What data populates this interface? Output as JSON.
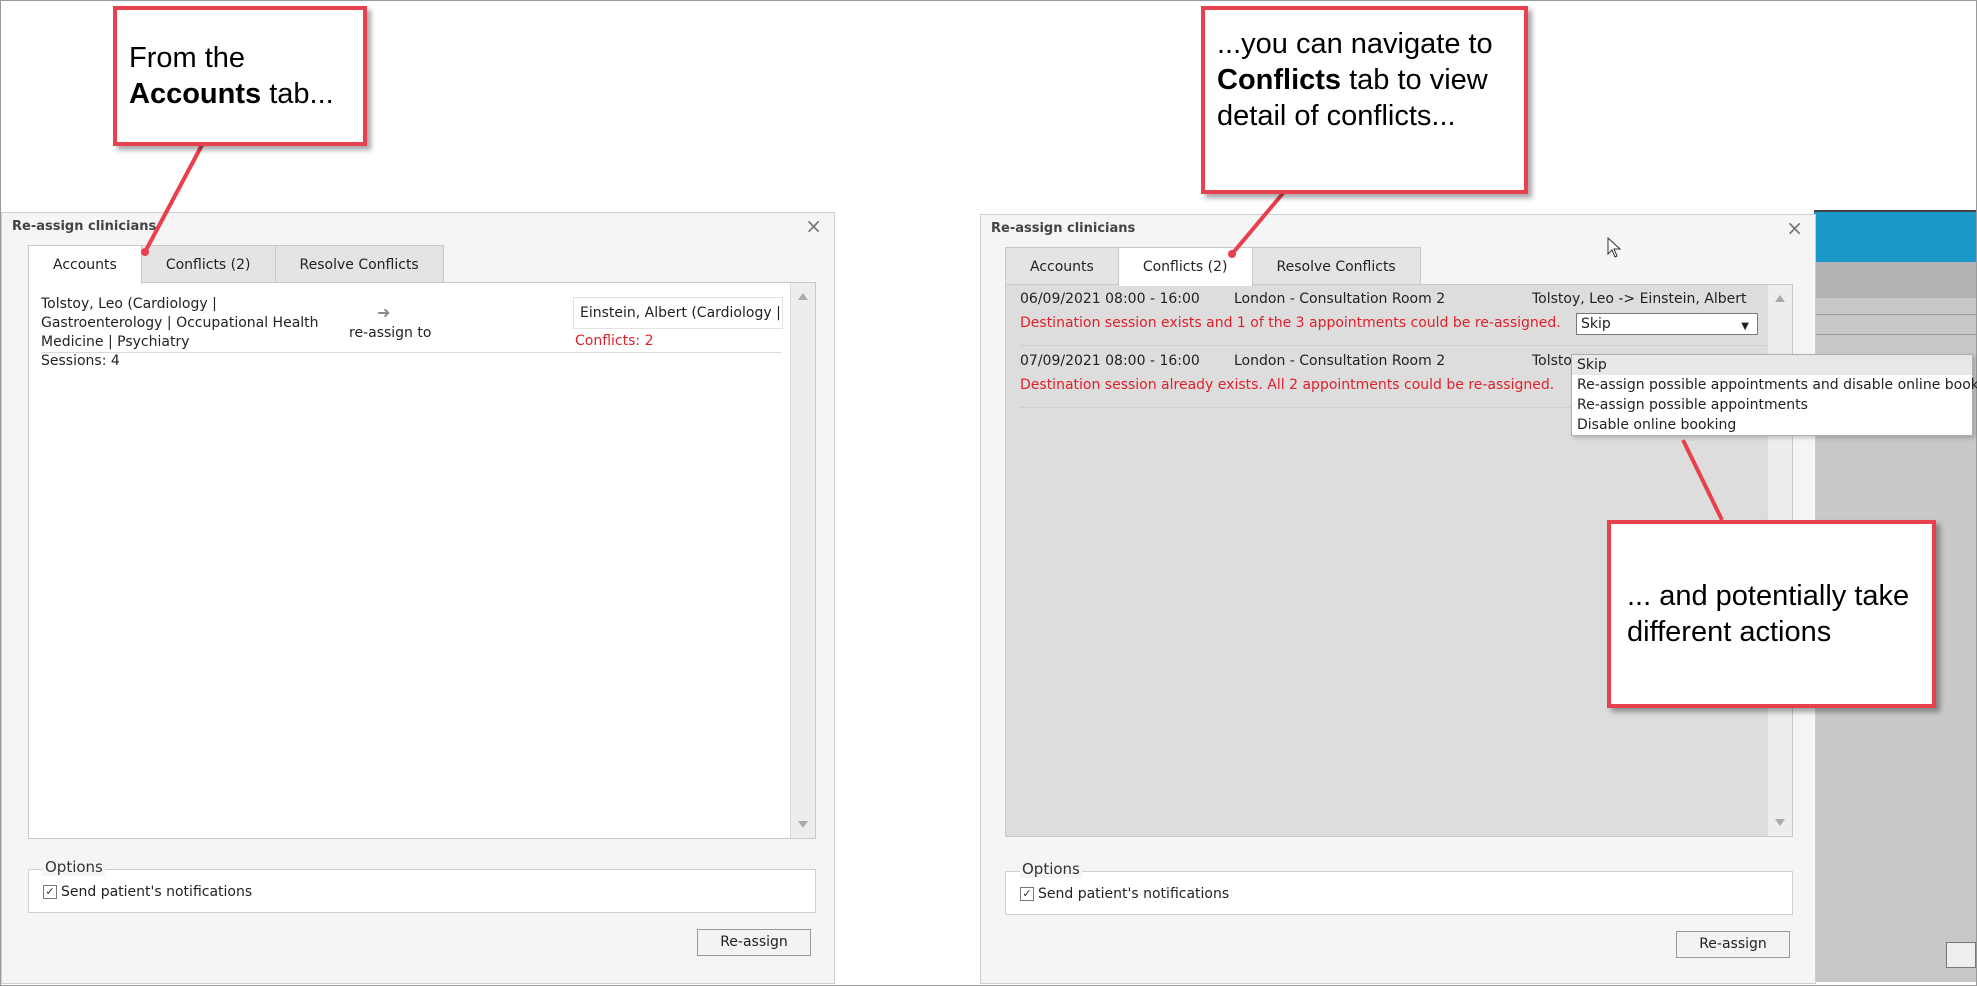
{
  "left_dialog": {
    "title": "Re-assign clinicians",
    "close": "×",
    "tabs": [
      {
        "label": "Accounts",
        "active": true
      },
      {
        "label": "Conflicts (2)",
        "active": false
      },
      {
        "label": "Resolve Conflicts",
        "active": false
      }
    ],
    "account": {
      "source": "Tolstoy, Leo (Cardiology | Gastroenterology | Occupational Health Medicine | Psychiatry",
      "sessions": "Sessions: 4",
      "reassign_label": "re-assign to",
      "target": "Einstein, Albert (Cardiology |",
      "conflicts": "Conflicts: 2"
    },
    "options_label": "Options",
    "notify_label": "Send patient's notifications",
    "reassign_button": "Re-assign"
  },
  "right_dialog": {
    "title": "Re-assign clinicians",
    "close": "×",
    "tabs": [
      {
        "label": "Accounts",
        "active": false
      },
      {
        "label": "Conflicts (2)",
        "active": true
      },
      {
        "label": "Resolve Conflicts",
        "active": false
      }
    ],
    "conflicts": [
      {
        "date": "06/09/2021 08:00 - 16:00",
        "room": "London - Consultation Room 2",
        "who": "Tolstoy, Leo -> Einstein, Albert",
        "message": "Destination session exists and 1 of the 3 appointments could be re-assigned.",
        "action": "Skip"
      },
      {
        "date": "07/09/2021 08:00 - 16:00",
        "room": "London - Consultation Room 2",
        "who": "Tolsto",
        "message": "Destination session already exists. All 2 appointments could be re-assigned."
      }
    ],
    "dropdown_options": [
      "Skip",
      "Re-assign possible appointments and disable online booking",
      "Re-assign possible appointments",
      "Disable online booking"
    ],
    "options_label": "Options",
    "notify_label": "Send patient's notifications",
    "reassign_button": "Re-assign"
  },
  "callouts": {
    "accounts_pre": "From the",
    "accounts_bold": "Accounts",
    "accounts_post": "tab...",
    "conflicts_pre": "...you can navigate to",
    "conflicts_bold": "Conflicts",
    "conflicts_post": "tab to view detail of conflicts...",
    "actions": "... and potentially take different actions"
  },
  "colors": {
    "callout_border": "#e8414d",
    "conflict_text": "#e0202a",
    "app_header": "#1a98c9"
  }
}
